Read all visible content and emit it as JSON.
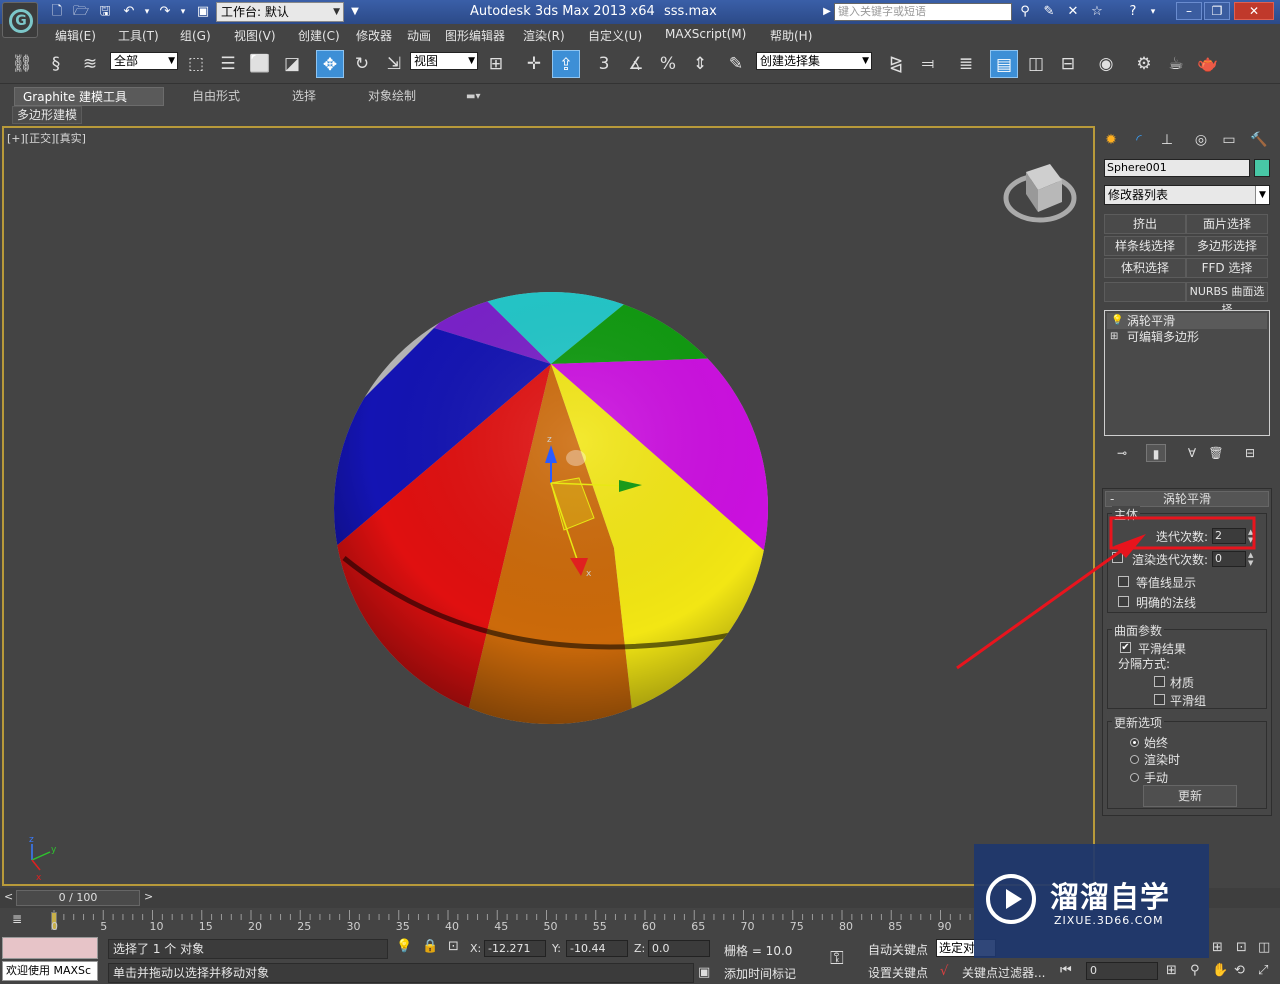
{
  "title_bar": {
    "workspace_label": "工作台: 默认",
    "app_title": "Autodesk 3ds Max  2013 x64",
    "file_name": "sss.max",
    "search_placeholder": "键入关键字或短语",
    "help_label": "?"
  },
  "menu": {
    "items": [
      "编辑(E)",
      "工具(T)",
      "组(G)",
      "视图(V)",
      "创建(C)",
      "修改器",
      "动画",
      "图形编辑器",
      "渲染(R)",
      "自定义(U)",
      "MAXScript(M)",
      "帮助(H)"
    ]
  },
  "toolbar": {
    "selection_filter": "全部",
    "reference_coord": "视图",
    "snap_labels": [
      "3",
      "%"
    ],
    "named_selection": "创建选择集"
  },
  "ribbon": {
    "tabs": [
      "Graphite 建模工具",
      "自由形式",
      "选择",
      "对象绘制"
    ],
    "sub_label": "多边形建模"
  },
  "viewport": {
    "label": "[+][正交][真实]",
    "gizmo_axes": [
      "z",
      "x"
    ],
    "corner_axes": [
      "z",
      "y",
      "x"
    ]
  },
  "command_panel": {
    "object_name": "Sphere001",
    "object_color": "#48c7a6",
    "modifier_list": "修改器列表",
    "modifier_buttons": [
      "挤出",
      "面片选择",
      "样条线选择",
      "多边形选择",
      "体积选择",
      "FFD 选择",
      "",
      "NURBS 曲面选择"
    ],
    "stack": [
      {
        "label": "涡轮平滑",
        "selected": true
      },
      {
        "label": "可编辑多边形",
        "selected": false
      }
    ],
    "rollout": {
      "title": "涡轮平滑",
      "main_group": "主体",
      "iterations_label": "迭代次数:",
      "iterations_value": "2",
      "render_iters_label": "渲染迭代次数:",
      "render_iters_value": "0",
      "isoline_label": "等值线显示",
      "explicit_normals_label": "明确的法线",
      "surface_group": "曲面参数",
      "smooth_result_label": "平滑结果",
      "separate_by_label": "分隔方式:",
      "materials_label": "材质",
      "smoothing_groups_label": "平滑组",
      "update_group": "更新选项",
      "always_label": "始终",
      "when_rendering_label": "渲染时",
      "manually_label": "手动",
      "update_button": "更新",
      "smooth_result_checked": true,
      "update_mode": "始终"
    }
  },
  "timeline": {
    "slider_text": "0 / 100",
    "ticks": [
      "0",
      "5",
      "10",
      "15",
      "20",
      "25",
      "30",
      "35",
      "40",
      "45",
      "50",
      "55",
      "60",
      "65",
      "70",
      "75",
      "80",
      "85",
      "90"
    ]
  },
  "status_bar": {
    "maxscript_text": "欢迎使用 MAXSc",
    "selection_info": "选择了 1 个 对象",
    "prompt": "单击并拖动以选择并移动对象",
    "x_label": "X:",
    "x_value": "-12.271",
    "y_label": "Y:",
    "y_value": "-10.44",
    "z_label": "Z:",
    "z_value": "0.0",
    "grid_text": "栅格 = 10.0",
    "add_time_tag": "添加时间标记",
    "auto_key": "自动关键点",
    "set_key": "设置关键点",
    "selected_set": "选定对",
    "key_filters": "关键点过滤器...",
    "frame_value": "0"
  },
  "watermark": {
    "title": "溜溜自学",
    "url": "ZIXUE.3D66.COM"
  },
  "colors": {
    "title_bar": "#2c4a88",
    "viewport_border": "#b89a3a",
    "highlight_box": "#e8141d",
    "annotation_arrow": "#e8141d"
  }
}
